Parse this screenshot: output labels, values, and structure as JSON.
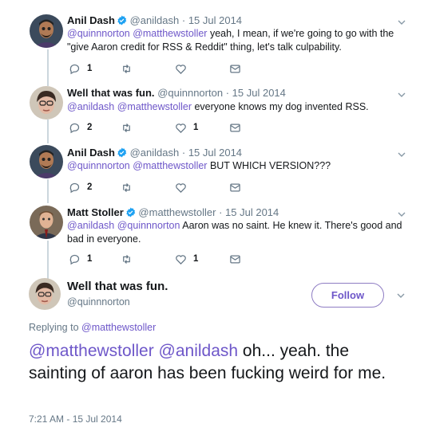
{
  "thread": [
    {
      "name": "Anil Dash",
      "verified": true,
      "handle": "@anildash",
      "separator": "·",
      "date": "15 Jul 2014",
      "mentions": "@quinnnorton @matthewstoller",
      "text": " yeah, I mean, if we're going to go with the \"give Aaron credit for RSS & Reddit\" thing, let's talk culpability.",
      "reply_count": "1",
      "retweet_count": "",
      "like_count": ""
    },
    {
      "name": "Well that was fun.",
      "verified": false,
      "handle": "@quinnnorton",
      "separator": "·",
      "date": "15 Jul 2014",
      "mentions": "@anildash @matthewstoller",
      "text": " everyone knows my dog invented RSS.",
      "reply_count": "2",
      "retweet_count": "",
      "like_count": "1"
    },
    {
      "name": "Anil Dash",
      "verified": true,
      "handle": "@anildash",
      "separator": "·",
      "date": "15 Jul 2014",
      "mentions": "@quinnnorton @matthewstoller",
      "text": " BUT WHICH VERSION???",
      "reply_count": "2",
      "retweet_count": "",
      "like_count": ""
    },
    {
      "name": "Matt Stoller",
      "verified": true,
      "handle": "@matthewstoller",
      "separator": "·",
      "date": "15 Jul 2014",
      "mentions": "@anildash @quinnnorton",
      "text": " Aaron was no saint. He knew it. There's good and bad in everyone.",
      "reply_count": "1",
      "retweet_count": "",
      "like_count": "1"
    }
  ],
  "main_tweet": {
    "name": "Well that was fun.",
    "handle": "@quinnnorton",
    "follow_label": "Follow",
    "replying_prefix": "Replying to ",
    "replying_to": "@matthewstoller",
    "mentions": "@matthewstoller @anildash",
    "text": " oh... yeah. the sainting of aaron has been fucking weird for me.",
    "timestamp": "7:21 AM - 15 Jul 2014"
  },
  "colors": {
    "accent": "#6e57c9",
    "muted": "#657786",
    "verified": "#1da1f2",
    "thread_line": "#ccd6dd"
  },
  "icons": [
    "reply-icon",
    "retweet-icon",
    "like-icon",
    "direct-message-icon",
    "chevron-down-icon",
    "verified-badge-icon"
  ]
}
